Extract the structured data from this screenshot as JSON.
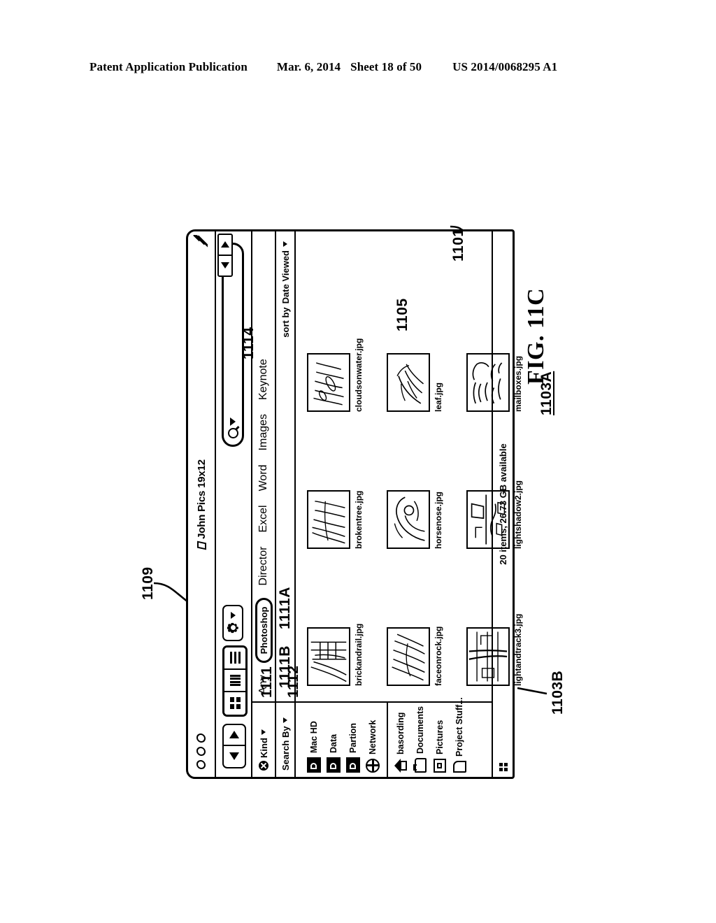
{
  "page_header": {
    "publication": "Patent Application Publication",
    "date": "Mar. 6, 2014",
    "sheet": "Sheet 18 of 50",
    "pub_number": "US 2014/0068295 A1"
  },
  "figure": {
    "label": "FIG. 11C",
    "reference_numerals": {
      "window": "1101",
      "sidebar_lower": "1103A",
      "sidebar_upper": "1103B",
      "content_area": "1105",
      "search_field": "1109",
      "filter_bar": "1111",
      "filter_selected": "1111B",
      "filter_options": "1111A",
      "search_by_row": "1112",
      "sort_control": "1114"
    }
  },
  "window": {
    "title": "John Pics 19x12",
    "title_icon": "document-icon",
    "traffic_lights": [
      "close-dot",
      "minimize-dot",
      "zoom-dot"
    ],
    "resize_grip": "resize-grip-icon"
  },
  "toolbar": {
    "back_icon": "triangle-left-icon",
    "forward_icon": "triangle-right-icon",
    "view_icon_mode": "icon-view-icon",
    "view_list_mode": "list-view-icon",
    "view_column_mode": "column-view-icon",
    "action_icon": "gear-icon",
    "action_caret": "chevron-down-icon",
    "search": {
      "icon": "magnifier-icon",
      "caret": "chevron-down-icon",
      "value": "",
      "placeholder": ""
    }
  },
  "criteria_bar": {
    "kind_label": "Kind",
    "kind_remove_icon": "remove-circle-icon",
    "kind_caret": "chevron-down-icon",
    "options": [
      {
        "label": "Any",
        "selected": false
      },
      {
        "label": "Photoshop",
        "selected": true
      },
      {
        "label": "Director",
        "selected": false
      },
      {
        "label": "Excel",
        "selected": false
      },
      {
        "label": "Word",
        "selected": false
      },
      {
        "label": "Images",
        "selected": false
      },
      {
        "label": "Keynote",
        "selected": false
      }
    ]
  },
  "sort_bar": {
    "search_by_label": "Search By",
    "search_by_caret": "chevron-down-icon",
    "sort_prefix": "sort by",
    "sort_value": "Date Viewed",
    "sort_caret": "chevron-down-icon"
  },
  "sidebar": {
    "groups": [
      {
        "items": [
          {
            "label": "Mac HD",
            "icon": "hard-disk-icon"
          },
          {
            "label": "Data",
            "icon": "hard-disk-icon"
          },
          {
            "label": "Partion",
            "icon": "hard-disk-icon"
          },
          {
            "label": "Network",
            "icon": "globe-icon"
          }
        ]
      },
      {
        "items": [
          {
            "label": "basording",
            "icon": "home-icon"
          },
          {
            "label": "Documents",
            "icon": "folder-icon"
          },
          {
            "label": "Pictures",
            "icon": "picture-folder-icon"
          },
          {
            "label": "Project Stuff...",
            "icon": "document-icon"
          }
        ]
      }
    ]
  },
  "files": [
    {
      "name": "brickandrail.jpg",
      "art": "brick"
    },
    {
      "name": "brokentree.jpg",
      "art": "tree"
    },
    {
      "name": "cloudsonwater.jpg",
      "art": "clouds"
    },
    {
      "name": "faceonrock.jpg",
      "art": "rock"
    },
    {
      "name": "horsenose.jpg",
      "art": "horse"
    },
    {
      "name": "leaf.jpg",
      "art": "leaf"
    },
    {
      "name": "lightandtrack3.jpg",
      "art": "track"
    },
    {
      "name": "lightshadow2.jpg",
      "art": "shadow"
    },
    {
      "name": "mailboxes.jpg",
      "art": "mailbox"
    }
  ],
  "scrollbar": {
    "left_arrow_icon": "triangle-left-icon",
    "right_arrow_icon": "triangle-right-icon"
  },
  "status_bar": {
    "text": "20 items, 26.73 GB available",
    "grip_icon": "resize-grip-icon"
  }
}
